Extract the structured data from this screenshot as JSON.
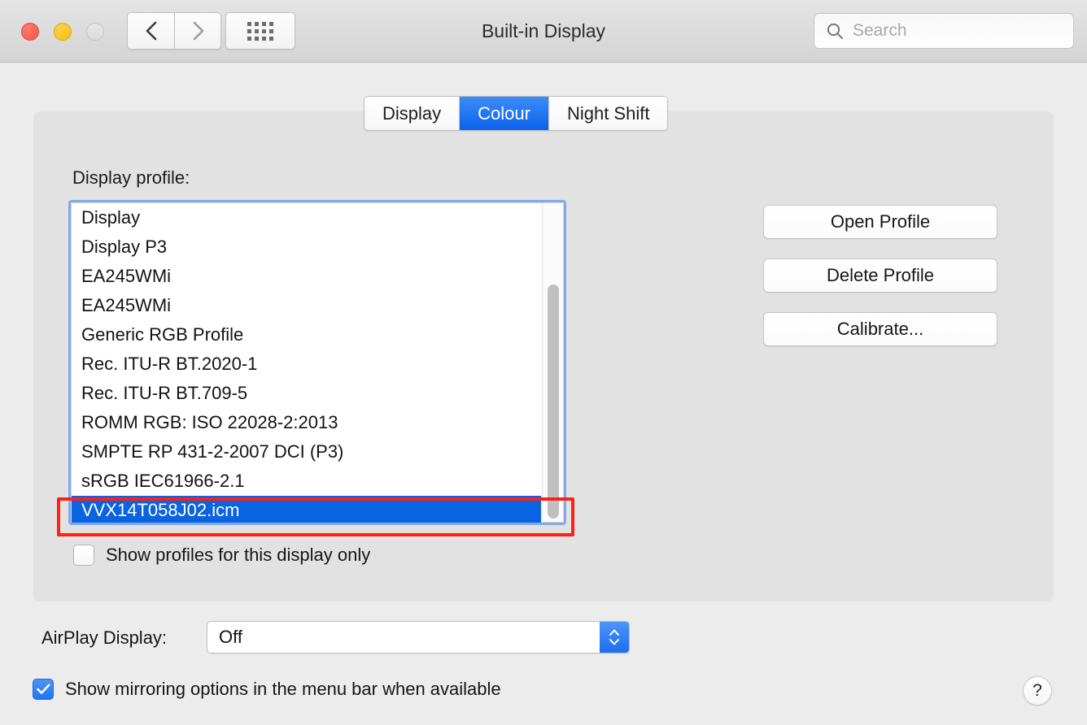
{
  "window": {
    "title": "Built-in Display",
    "traffic_lights": [
      "close",
      "minimize",
      "zoom"
    ]
  },
  "toolbar": {
    "back_icon": "chevron-left-icon",
    "forward_icon": "chevron-right-icon",
    "grid_icon": "show-all-grid-icon",
    "search": {
      "icon": "search-icon",
      "placeholder": "Search",
      "value": ""
    }
  },
  "tabs": [
    {
      "label": "Display",
      "selected": false
    },
    {
      "label": "Colour",
      "selected": true
    },
    {
      "label": "Night Shift",
      "selected": false
    }
  ],
  "panel": {
    "profile_label": "Display profile:",
    "profiles": [
      "Display",
      "Display P3",
      "EA245WMi",
      "EA245WMi",
      "Generic RGB Profile",
      "Rec. ITU-R BT.2020-1",
      "Rec. ITU-R BT.709-5",
      "ROMM RGB: ISO 22028-2:2013",
      "SMPTE RP 431-2-2007 DCI (P3)",
      "sRGB IEC61966-2.1",
      "VVX14T058J02.icm"
    ],
    "selected_profile": "VVX14T058J02.icm",
    "selected_index": 10,
    "show_profiles_checkbox": {
      "label": "Show profiles for this display only",
      "checked": false
    },
    "buttons": [
      {
        "label": "Open Profile"
      },
      {
        "label": "Delete Profile"
      },
      {
        "label": "Calibrate..."
      }
    ]
  },
  "airplay": {
    "label": "AirPlay Display:",
    "value": "Off",
    "options": [
      "Off"
    ],
    "stepper_icon": "up-down-chevrons-icon"
  },
  "mirroring_checkbox": {
    "label": "Show mirroring options in the menu bar when available",
    "checked": true
  },
  "help_button": {
    "label": "?"
  },
  "colors": {
    "accent_blue": "#0a63e0",
    "tab_selected_blue": "#1a6ef2",
    "focus_ring_blue": "#82a9e8",
    "annotation_red": "#fc2018",
    "window_bg": "#ececec",
    "panel_bg": "#e2e2e2"
  }
}
